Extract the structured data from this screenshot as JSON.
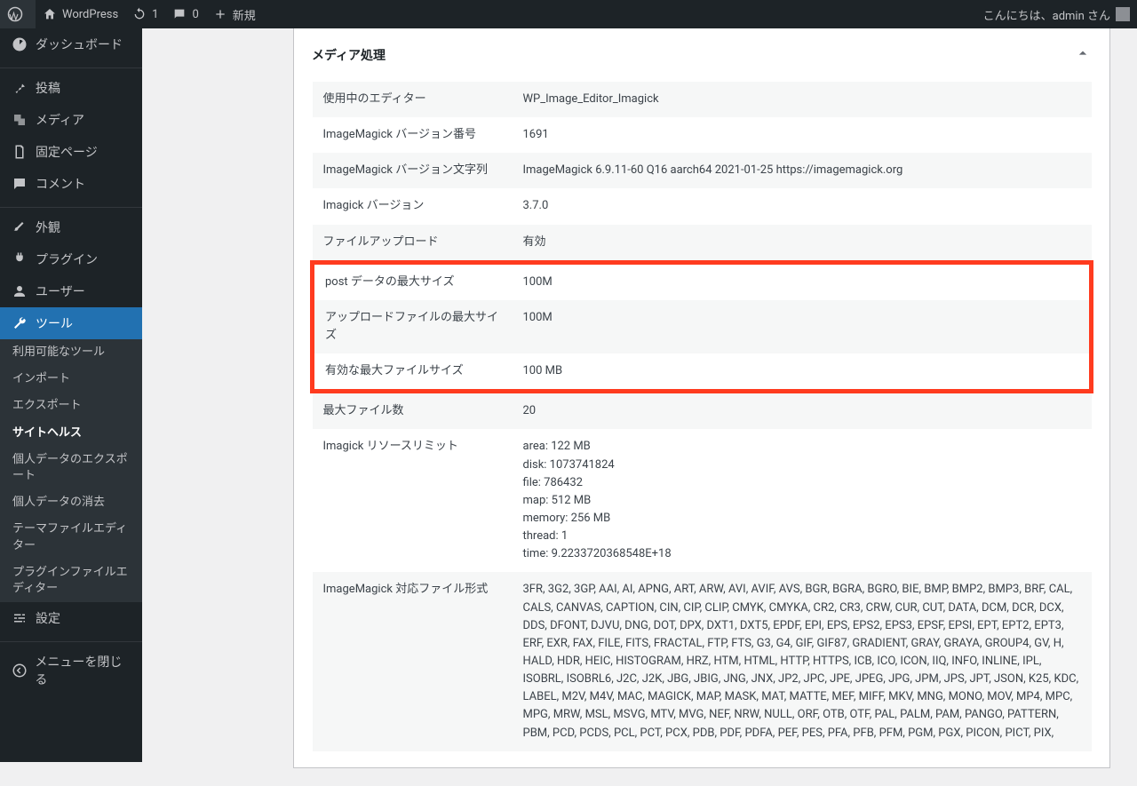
{
  "adminbar": {
    "site_name": "WordPress",
    "updates": "1",
    "comments": "0",
    "new": "新規",
    "greeting": "こんにちは、admin さん"
  },
  "sidebar": {
    "dashboard": "ダッシュボード",
    "posts": "投稿",
    "media": "メディア",
    "pages": "固定ページ",
    "comments": "コメント",
    "appearance": "外観",
    "plugins": "プラグイン",
    "users": "ユーザー",
    "tools": "ツール",
    "tools_submenu": {
      "available": "利用可能なツール",
      "import": "インポート",
      "export": "エクスポート",
      "site_health": "サイトヘルス",
      "export_data": "個人データのエクスポート",
      "erase_data": "個人データの消去",
      "theme_editor": "テーマファイルエディター",
      "plugin_editor": "プラグインファイルエディター"
    },
    "settings": "設定",
    "collapse": "メニューを閉じる"
  },
  "panel": {
    "title": "メディア処理",
    "rows": [
      {
        "label": "使用中のエディター",
        "value": "WP_Image_Editor_Imagick"
      },
      {
        "label": "ImageMagick バージョン番号",
        "value": "1691"
      },
      {
        "label": "ImageMagick バージョン文字列",
        "value": "ImageMagick 6.9.11-60 Q16 aarch64 2021-01-25 https://imagemagick.org"
      },
      {
        "label": "Imagick バージョン",
        "value": "3.7.0"
      },
      {
        "label": "ファイルアップロード",
        "value": "有効"
      },
      {
        "label": "post データの最大サイズ",
        "value": "100M",
        "hl": true
      },
      {
        "label": "アップロードファイルの最大サイズ",
        "value": "100M",
        "hl": true
      },
      {
        "label": "有効な最大ファイルサイズ",
        "value": "100 MB",
        "hl": true
      },
      {
        "label": "最大ファイル数",
        "value": "20"
      }
    ],
    "resource_limits": {
      "label": "Imagick リソースリミット",
      "lines": [
        "area: 122 MB",
        "disk: 1073741824",
        "file: 786432",
        "map: 512 MB",
        "memory: 256 MB",
        "thread: 1",
        "time: 9.2233720368548E+18"
      ]
    },
    "formats": {
      "label": "ImageMagick 対応ファイル形式",
      "value": "3FR, 3G2, 3GP, AAI, AI, APNG, ART, ARW, AVI, AVIF, AVS, BGR, BGRA, BGRO, BIE, BMP, BMP2, BMP3, BRF, CAL, CALS, CANVAS, CAPTION, CIN, CIP, CLIP, CMYK, CMYKA, CR2, CR3, CRW, CUR, CUT, DATA, DCM, DCR, DCX, DDS, DFONT, DJVU, DNG, DOT, DPX, DXT1, DXT5, EPDF, EPI, EPS, EPS2, EPS3, EPSF, EPSI, EPT, EPT2, EPT3, ERF, EXR, FAX, FILE, FITS, FRACTAL, FTP, FTS, G3, G4, GIF, GIF87, GRADIENT, GRAY, GRAYA, GROUP4, GV, H, HALD, HDR, HEIC, HISTOGRAM, HRZ, HTM, HTML, HTTP, HTTPS, ICB, ICO, ICON, IIQ, INFO, INLINE, IPL, ISOBRL, ISOBRL6, J2C, J2K, JBG, JBIG, JNG, JNX, JP2, JPC, JPE, JPEG, JPG, JPM, JPS, JPT, JSON, K25, KDC, LABEL, M2V, M4V, MAC, MAGICK, MAP, MASK, MAT, MATTE, MEF, MIFF, MKV, MNG, MONO, MOV, MP4, MPC, MPG, MRW, MSL, MSVG, MTV, MVG, NEF, NRW, NULL, ORF, OTB, OTF, PAL, PALM, PAM, PANGO, PATTERN, PBM, PCD, PCDS, PCL, PCT, PCX, PDB, PDF, PDFA, PEF, PES, PFA, PFB, PFM, PGM, PGX, PICON, PICT, PIX,"
    }
  }
}
